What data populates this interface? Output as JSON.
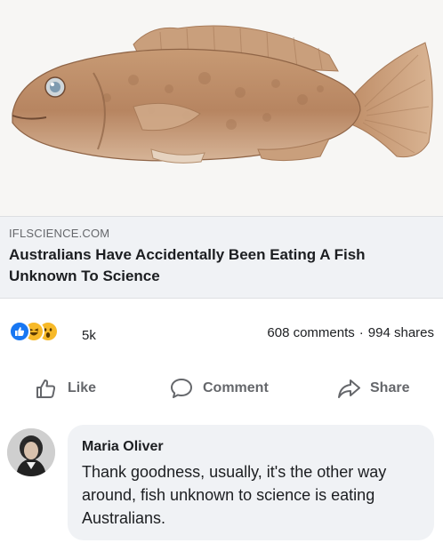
{
  "post": {
    "image": {
      "icon": "grouper-fish-photo",
      "background": "#f7f6f4"
    },
    "link": {
      "domain": "IFLSCIENCE.COM",
      "headline": "Australians Have Accidentally Been Eating A Fish Unknown To Science"
    },
    "stats": {
      "reactions": [
        "like-reaction-icon",
        "haha-reaction-icon",
        "wow-reaction-icon"
      ],
      "reaction_count": "5k",
      "comments": "608 comments",
      "separator": "·",
      "shares": "994 shares"
    },
    "actions": {
      "like_label": "Like",
      "comment_label": "Comment",
      "share_label": "Share"
    },
    "comment": {
      "author": "Maria Oliver",
      "text": "Thank goodness, usually, it's the other way around, fish unknown to science is eating Australians."
    }
  },
  "colors": {
    "brand_blue": "#1877f2",
    "reaction_yellow": "#f7b928",
    "muted_text": "#65676b",
    "bubble_bg": "#f0f2f5"
  }
}
